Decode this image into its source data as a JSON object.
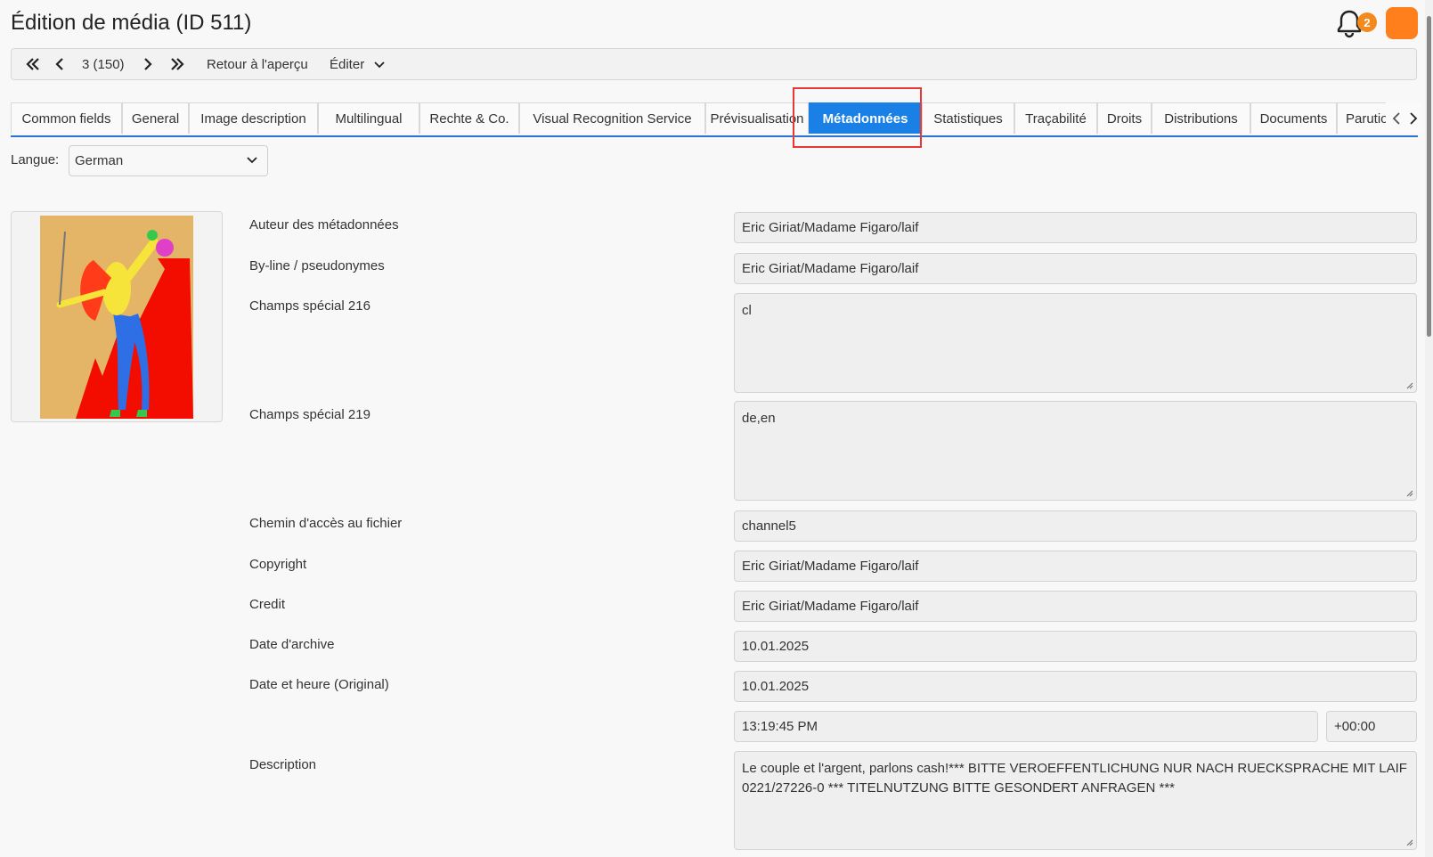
{
  "page": {
    "title": "Édition de média (ID 511)"
  },
  "header": {
    "notification_count": "2",
    "avatar_color": "#ff7f1c"
  },
  "toolbar": {
    "first_icon": "double-chevron-left-icon",
    "prev_icon": "chevron-left-icon",
    "position": "3 (150)",
    "next_icon": "chevron-right-icon",
    "last_icon": "double-chevron-right-icon",
    "back_label": "Retour à l'aperçu",
    "edit_label": "Éditer"
  },
  "tabs": [
    "Common fields",
    "General",
    "Image description",
    "Multilingual",
    "Rechte & Co.",
    "Visual Recognition Service",
    "Prévisualisation",
    "Métadonnées",
    "Statistiques",
    "Traçabilité",
    "Droits",
    "Distributions",
    "Documents",
    "Parution"
  ],
  "active_tab": "Métadonnées",
  "language": {
    "label": "Langue:",
    "value": "German"
  },
  "fields": {
    "author": {
      "label": "Auteur des métadonnées",
      "value": "Eric Giriat/Madame Figaro/laif"
    },
    "byline": {
      "label": "By-line / pseudonymes",
      "value": "Eric Giriat/Madame Figaro/laif"
    },
    "special216": {
      "label": "Champs spécial 216",
      "value": "cl"
    },
    "special219": {
      "label": "Champs spécial 219",
      "value": "de,en"
    },
    "filepath": {
      "label": "Chemin d'accès au fichier",
      "value": "channel5"
    },
    "copyright": {
      "label": "Copyright",
      "value": "Eric Giriat/Madame Figaro/laif"
    },
    "credit": {
      "label": "Credit",
      "value": "Eric Giriat/Madame Figaro/laif"
    },
    "archive_date": {
      "label": "Date d'archive",
      "value": "10.01.2025"
    },
    "datetime_original": {
      "label": "Date et heure (Original)",
      "value": "10.01.2025",
      "time": "13:19:45 PM",
      "tz": "+00:00"
    },
    "description": {
      "label": "Description",
      "value": "Le couple et l'argent, parlons cash!*** BITTE VEROEFFENTLICHUNG NUR NACH RUECKSPRACHE MIT LAIF 0221/27226-0 *** TITELNUTZUNG BITTE GESONDERT ANFRAGEN ***"
    }
  },
  "colors": {
    "accent": "#1a80e6",
    "highlight": "#e53935",
    "badge": "#f28a1e"
  }
}
